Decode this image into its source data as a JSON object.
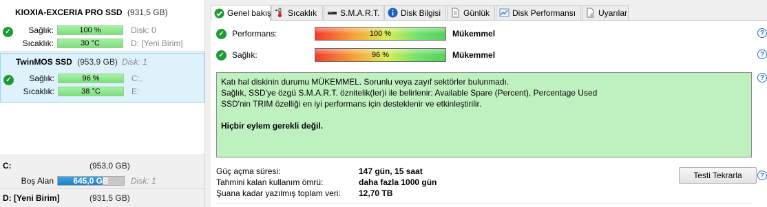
{
  "disks": [
    {
      "name": "KIOXIA-EXCERIA PRO SSD",
      "capacity": "(931,5 GB)",
      "disk_number": "",
      "health_label": "Sağlık:",
      "health_value": "100 %",
      "temp_label": "Sıcaklık:",
      "temp_value": "30 °C",
      "info1": "Disk: 0",
      "info2": "D: [Yeni Birim]"
    },
    {
      "name": "TwinMOS SSD",
      "capacity": "(953,9 GB)",
      "disk_number": "Disk: 1",
      "health_label": "Sağlık:",
      "health_value": "96 %",
      "temp_label": "Sıcaklık:",
      "temp_value": "38 °C",
      "info1": "C:,",
      "info2": "E:"
    }
  ],
  "volumes": [
    {
      "name": "C:",
      "capacity": "(953,0 GB)",
      "free_label": "Boş Alan",
      "free_value": "645,0 GB",
      "free_fraction": 0.68,
      "disk": "Disk: 1"
    },
    {
      "name": "D: [Yeni Birim]",
      "capacity": "(931,5 GB)"
    }
  ],
  "tabs": [
    {
      "label": "Genel bakış",
      "icon": "check-circle-icon"
    },
    {
      "label": "Sıcaklık",
      "icon": "thermometer-icon"
    },
    {
      "label": "S.M.A.R.T.",
      "icon": "drive-icon"
    },
    {
      "label": "Disk Bilgisi",
      "icon": "info-icon"
    },
    {
      "label": "Günlük",
      "icon": "document-icon"
    },
    {
      "label": "Disk Performansı",
      "icon": "chart-icon"
    },
    {
      "label": "Uyarılar",
      "icon": "alert-page-icon"
    }
  ],
  "overview": {
    "performance_label": "Performans:",
    "performance_value": "100 %",
    "performance_rating": "Mükemmel",
    "health_label": "Sağlık:",
    "health_value": "96 %",
    "health_rating": "Mükemmel",
    "status_lines": [
      "Katı hal diskinin durumu MÜKEMMEL. Sorunlu veya zayıf sektörler bulunmadı.",
      "Sağlık, SSD'ye özgü S.M.A.R.T. öznitelik(ler)i ile belirlenir:  Available Spare (Percent), Percentage Used",
      "SSD'nin TRIM özelliği en iyi performans için desteklenir ve etkinleştirilir."
    ],
    "status_action": "Hiçbir eylem gerekli değil.",
    "power_on_label": "Güç açma süresi:",
    "power_on_value": "147 gün, 15 saat",
    "lifetime_label": "Tahmini kalan kullanım ömrü:",
    "lifetime_value": "daha fazla 1000 gün",
    "written_label": "Şuana kadar yazılmış toplam veri:",
    "written_value": "12,70 TB",
    "retest_button": "Testi Tekrarla"
  },
  "colors": {
    "ok_green": "#1e9a35",
    "status_bg": "#bff0bf",
    "selected_bg": "#ddf2fb",
    "free_bar": "#1f7fc4",
    "help_blue": "#2c6ebd"
  }
}
